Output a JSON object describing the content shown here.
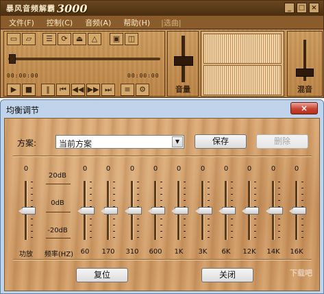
{
  "app": {
    "title": "暴风音频解霸",
    "logo_text": "3000",
    "window_buttons": [
      "_",
      "□",
      "×"
    ]
  },
  "menu": [
    {
      "label": "文件(F)"
    },
    {
      "label": "控制(C)"
    },
    {
      "label": "音频(A)"
    },
    {
      "label": "帮助(H)"
    },
    {
      "label": "|选曲|"
    }
  ],
  "player": {
    "time_left": "00:00:00",
    "time_right": "00:00:00",
    "volume_label": "音量",
    "mix_label": "混音",
    "toolbar_top_icons": [
      "open-folder-icon",
      "open-file-icon",
      "playlist-icon",
      "loop-icon",
      "eject-icon",
      "stop-icon",
      "screen-icon",
      "mini-icon"
    ],
    "toolbar_bottom_icons": [
      "play-icon",
      "stop-icon",
      "pause-icon",
      "prev-icon",
      "rewind-icon",
      "forward-icon",
      "next-icon",
      "list-icon",
      "settings-icon"
    ]
  },
  "dialog": {
    "title": "均衡调节",
    "close_label": "×",
    "preset_label": "方案:",
    "preset_value": "当前方案",
    "save_label": "保存",
    "delete_label": "删除",
    "reset_label": "复位",
    "close_button_label": "关闭",
    "freq_axis_label": "频率(HZ)",
    "db_labels": [
      "20dB",
      "0dB",
      "-20dB"
    ],
    "watermark": "下载吧"
  },
  "bands": [
    {
      "name": "功放",
      "value": "0"
    },
    {
      "name": "60",
      "value": "0"
    },
    {
      "name": "170",
      "value": "0"
    },
    {
      "name": "310",
      "value": "0"
    },
    {
      "name": "600",
      "value": "0"
    },
    {
      "name": "1K",
      "value": "0"
    },
    {
      "name": "3K",
      "value": "0"
    },
    {
      "name": "6K",
      "value": "0"
    },
    {
      "name": "12K",
      "value": "0"
    },
    {
      "name": "14K",
      "value": "0"
    },
    {
      "name": "16K",
      "value": "0"
    }
  ]
}
